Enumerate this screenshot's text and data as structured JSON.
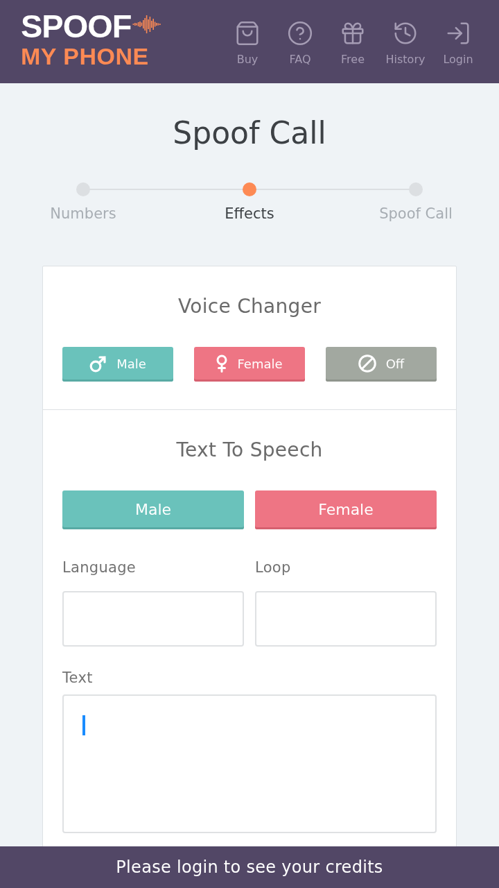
{
  "header": {
    "logo": {
      "line_1": "SPOOF",
      "line_2": "MY PHONE"
    },
    "nav": [
      {
        "label": "Buy",
        "kind": "buy"
      },
      {
        "label": "FAQ",
        "kind": "faq"
      },
      {
        "label": "Free",
        "kind": "free"
      },
      {
        "label": "History",
        "kind": "history"
      },
      {
        "label": "Login",
        "kind": "login"
      }
    ]
  },
  "title": "Spoof Call",
  "steps": [
    {
      "label": "Numbers",
      "selected": false
    },
    {
      "label": "Effects",
      "selected": true
    },
    {
      "label": "Spoof Call",
      "selected": false
    }
  ],
  "voice_changer": {
    "title": "Voice Changer",
    "buttons": [
      {
        "label": "Male",
        "kind": "male"
      },
      {
        "label": "Female",
        "kind": "female"
      },
      {
        "label": "Off",
        "kind": "off"
      }
    ]
  },
  "text_to_speech": {
    "title": "Text To Speech",
    "buttons": [
      {
        "label": "Male",
        "kind": "male"
      },
      {
        "label": "Female",
        "kind": "female"
      }
    ],
    "fields": [
      {
        "label": "Language"
      },
      {
        "label": "Loop"
      }
    ],
    "text": {
      "label": "Text",
      "focused": true
    }
  },
  "footer": {
    "message": "Please login to see your credits"
  }
}
